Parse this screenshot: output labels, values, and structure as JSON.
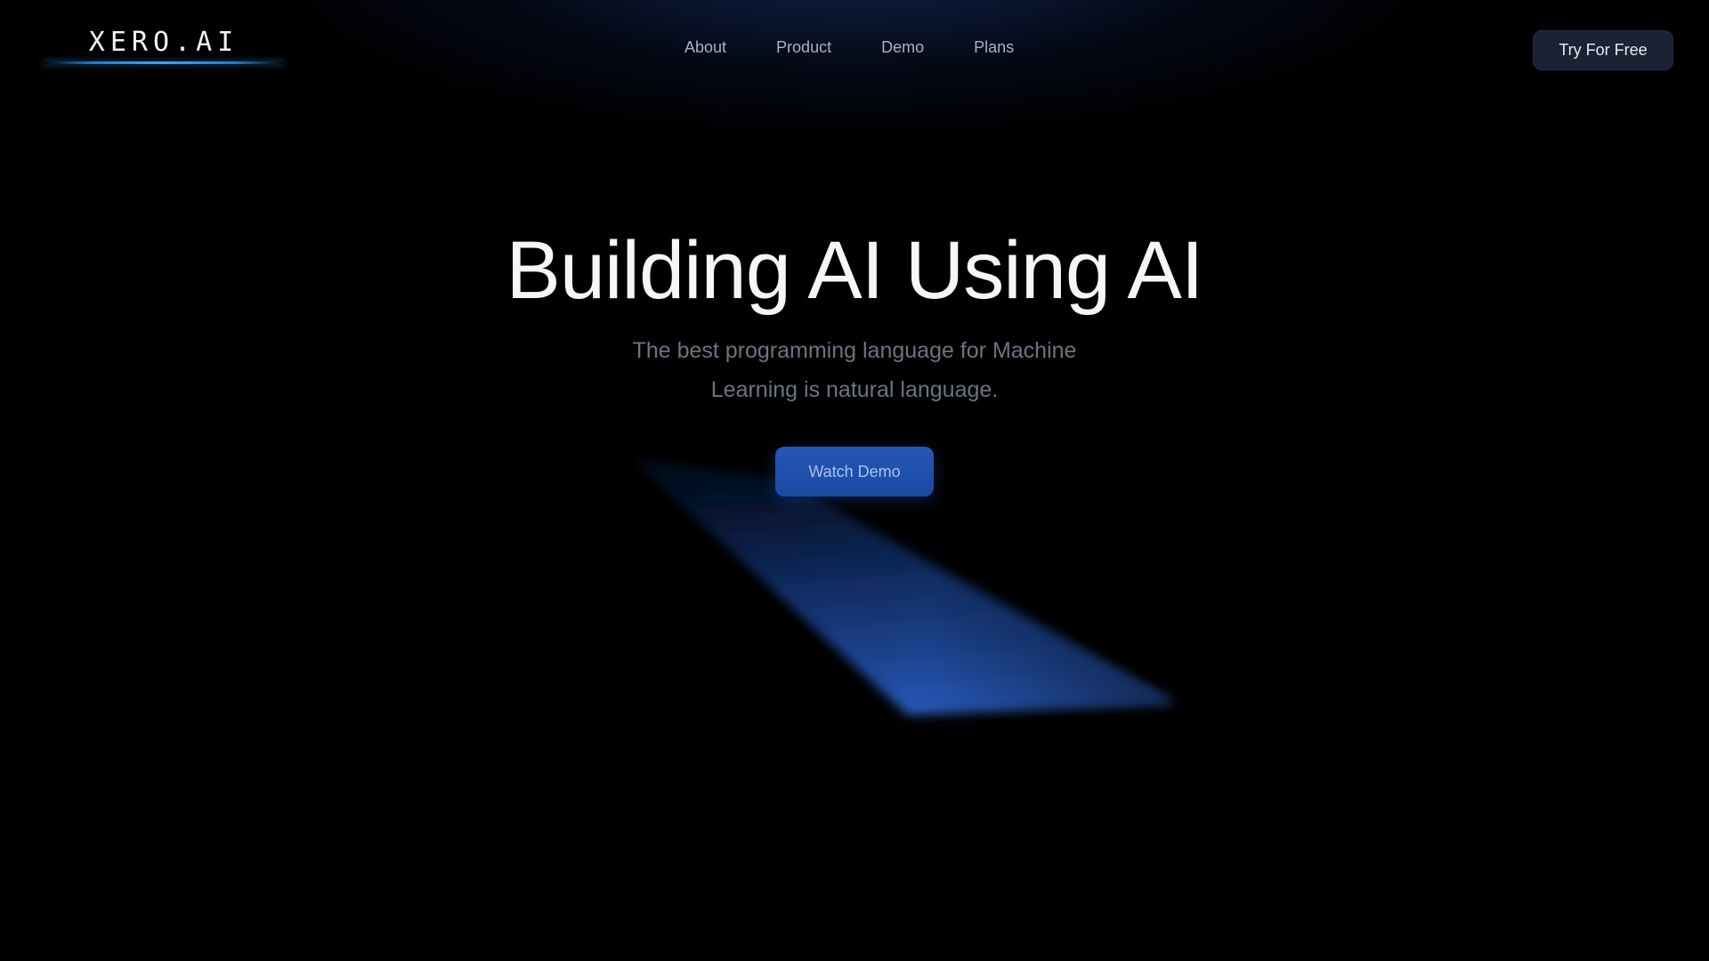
{
  "brand": {
    "logo_text": "XERO.AI"
  },
  "nav": {
    "items": [
      {
        "label": "About"
      },
      {
        "label": "Product"
      },
      {
        "label": "Demo"
      },
      {
        "label": "Plans"
      }
    ]
  },
  "header": {
    "cta_label": "Try For Free"
  },
  "hero": {
    "title": "Building AI Using AI",
    "subtitle_line1": "The best programming language for Machine",
    "subtitle_line2": "Learning is natural language.",
    "cta_label": "Watch Demo"
  },
  "colors": {
    "background": "#000000",
    "accent_blue": "#2357b8",
    "logo_glow": "#38a6ff",
    "nav_text": "#aab2c0",
    "subtitle_text": "#6c7381"
  }
}
